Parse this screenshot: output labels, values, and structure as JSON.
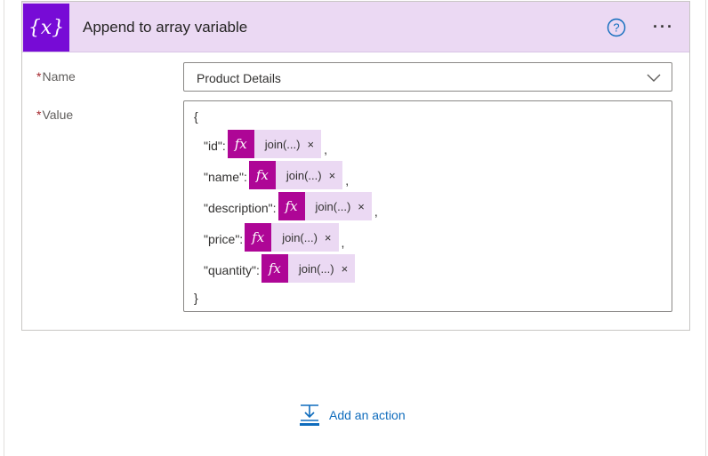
{
  "card": {
    "title": "Append to array variable",
    "icon": "variable-icon",
    "header_color": "#ebd9f3",
    "icon_bg_color": "#770bd6",
    "more_label": "···"
  },
  "fields": {
    "required_mark": "*",
    "name_label": "Name",
    "name_value": "Product Details",
    "value_label": "Value"
  },
  "editor": {
    "open_brace": "{",
    "close_brace": "}",
    "lines": [
      {
        "key": "\"id\":",
        "token": "join(...)",
        "suffix": ","
      },
      {
        "key": "\"name\":",
        "token": "join(...)",
        "suffix": ","
      },
      {
        "key": "\"description\":",
        "token": "join(...)",
        "suffix": ","
      },
      {
        "key": "\"price\":",
        "token": "join(...)",
        "suffix": ","
      },
      {
        "key": "\"quantity\":",
        "token": "join(...)",
        "suffix": ""
      }
    ],
    "fx_label": "fx",
    "remove_label": "×",
    "token_color": "#ae0696"
  },
  "footer": {
    "add_action_label": "Add an action",
    "link_color": "#0f6cbd"
  }
}
